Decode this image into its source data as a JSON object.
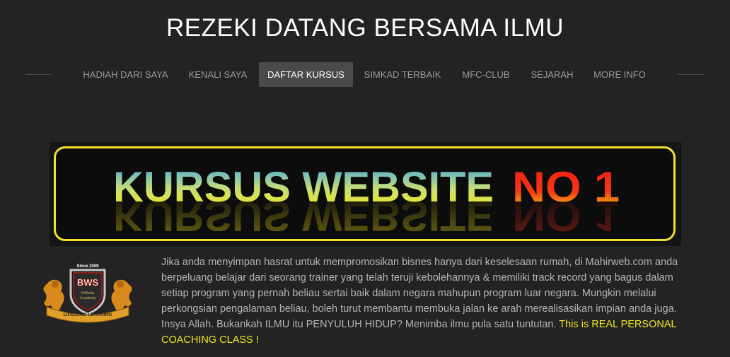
{
  "header": {
    "title": "REZEKI DATANG BERSAMA ILMU"
  },
  "nav": {
    "items": [
      {
        "label": "HADIAH DARI SAYA"
      },
      {
        "label": "KENALI SAYA"
      },
      {
        "label": "DAFTAR KURSUS",
        "active": true
      },
      {
        "label": "SIMKAD TERBAIK"
      },
      {
        "label": "MFC-CLUB"
      },
      {
        "label": "SEJARAH"
      },
      {
        "label": "MORE INFO"
      }
    ]
  },
  "banner": {
    "text_main": "KURSUS WEBSITE",
    "text_accent": "NO 1",
    "border_color": "#f2e22a"
  },
  "logo": {
    "since": "Since 2009",
    "initials": "BWS",
    "line1": "Website",
    "line2": "Academy",
    "ribbon": "LIFELONG LEARNING"
  },
  "content": {
    "paragraph": "Jika anda menyimpan hasrat untuk mempromosikan bisnes hanya dari keselesaan rumah, di Mahirweb.com anda berpeluang belajar dari seorang trainer yang telah teruji  kebolehannya & memiliki track record yang bagus dalam setiap program yang pernah beliau sertai baik dalam negara mahupun program luar negara. Mungkin melalui perkongsian pengalaman beliau, boleh turut membantu membuka jalan ke arah merealisasikan impian anda juga. Insya Allah. Bukankah ILMU  itu PENYULUH HIDUP? Menimba ilmu pula satu tuntutan.",
    "highlight": "This is REAL PERSONAL COACHING CLASS !",
    "highlight_color": "#f3e526"
  }
}
